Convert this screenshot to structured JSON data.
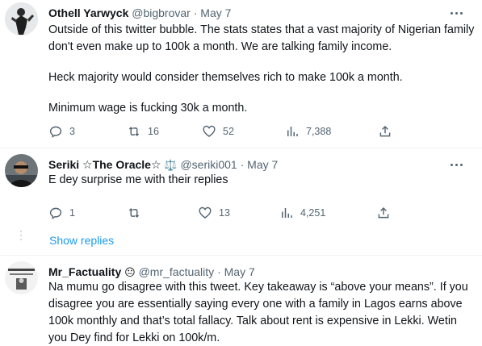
{
  "tweets": [
    {
      "name": "Othell Yarwyck",
      "handle": "@bigbrovar",
      "date": "May 7",
      "paragraphs": [
        "Outside of this twitter bubble. The stats states that a vast majority of Nigerian family don't even make up to 100k a month. We are talking family income.",
        "Heck majority would consider themselves rich to make 100k a month.",
        "Minimum wage is fucking 30k a month."
      ],
      "replies": "3",
      "retweets": "16",
      "likes": "52",
      "views": "7,388"
    },
    {
      "name": "Seriki ☆The Oracle☆",
      "name_emoji": "⚖️",
      "handle": "@seriki001",
      "date": "May 7",
      "paragraphs": [
        "E dey surprise me with their replies"
      ],
      "replies": "1",
      "retweets": "",
      "likes": "13",
      "views": "4,251"
    },
    {
      "name": "Mr_Factuality",
      "name_emoji": "😐",
      "handle": "@mr_factuality",
      "date": "May 7",
      "paragraphs": [
        "Na mumu go disagree with this tweet. Key takeaway is “above your means”. If you disagree you are essentially saying every one with a family in Lagos earns above 100k monthly and that’s total fallacy. Talk about rent is expensive in Lekki. Wetin you Dey find for Lekki on 100k/m."
      ]
    }
  ],
  "show_replies": "Show replies",
  "icons": {
    "reply": "reply-icon",
    "retweet": "retweet-icon",
    "like": "heart-icon",
    "views": "views-icon",
    "share": "share-icon",
    "more": "more-icon"
  },
  "colors": {
    "link": "#1d9bf0",
    "secondary_text": "#536471",
    "primary_text": "#0f1419"
  }
}
